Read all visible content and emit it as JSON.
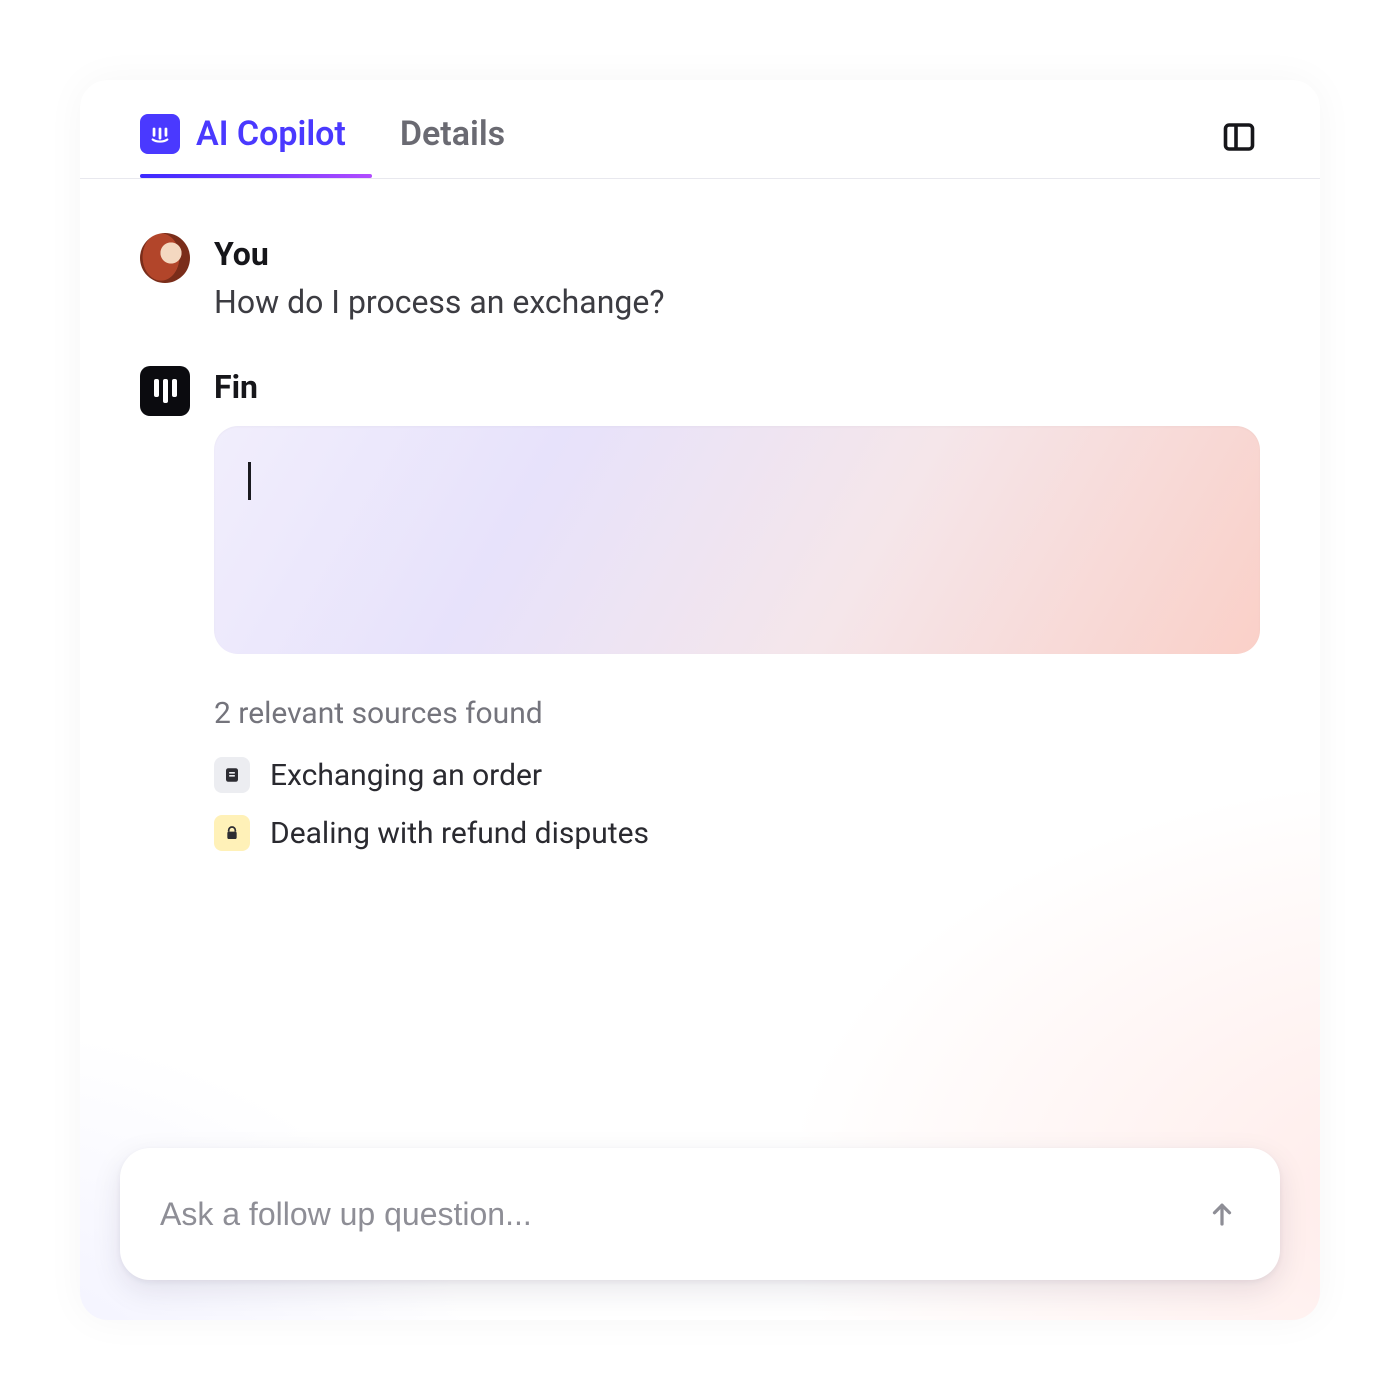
{
  "tabs": {
    "copilot_label": "AI Copilot",
    "details_label": "Details"
  },
  "conversation": {
    "user": {
      "name": "You",
      "message": "How do I process an exchange?"
    },
    "assistant": {
      "name": "Fin",
      "response": ""
    }
  },
  "sources": {
    "count": 2,
    "heading": "2 relevant sources found",
    "items": [
      {
        "icon": "document",
        "title": "Exchanging an order"
      },
      {
        "icon": "lock",
        "title": "Dealing with refund disputes"
      }
    ]
  },
  "composer": {
    "placeholder": "Ask a follow up question..."
  },
  "colors": {
    "accent": "#4a39ff"
  }
}
